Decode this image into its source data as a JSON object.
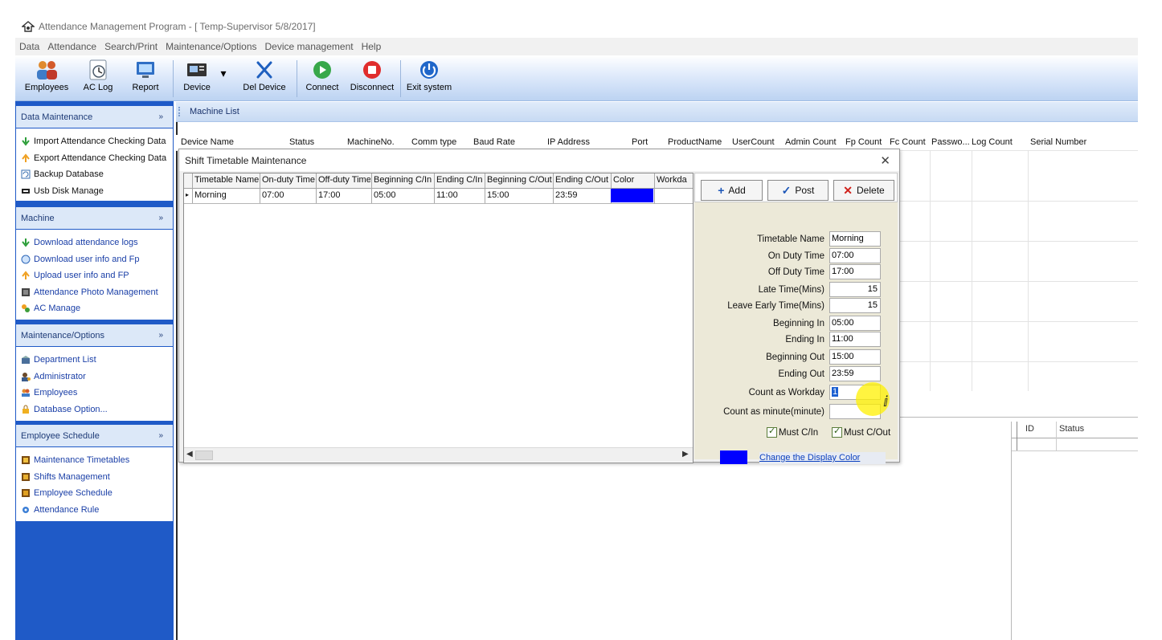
{
  "window": {
    "title": "Attendance Management Program - [ Temp-Supervisor 5/8/2017]"
  },
  "menu": [
    "Data",
    "Attendance",
    "Search/Print",
    "Maintenance/Options",
    "Device management",
    "Help"
  ],
  "toolbar": {
    "employees": "Employees",
    "ac_log": "AC Log",
    "report": "Report",
    "device": "Device",
    "del_device": "Del Device",
    "connect": "Connect",
    "disconnect": "Disconnect",
    "exit_system": "Exit system"
  },
  "sidebar": {
    "groups": [
      {
        "title": "Data Maintenance",
        "items": [
          "Import Attendance Checking Data",
          "Export Attendance Checking Data",
          "Backup Database",
          "Usb Disk Manage"
        ]
      },
      {
        "title": "Machine",
        "items": [
          "Download attendance logs",
          "Download user info and Fp",
          "Upload user info and FP",
          "Attendance Photo Management",
          "AC Manage"
        ]
      },
      {
        "title": "Maintenance/Options",
        "items": [
          "Department List",
          "Administrator",
          "Employees",
          "Database Option..."
        ]
      },
      {
        "title": "Employee Schedule",
        "items": [
          "Maintenance Timetables",
          "Shifts Management",
          "Employee Schedule",
          "Attendance Rule"
        ]
      }
    ],
    "collapse_glyph": "»"
  },
  "machine_list": {
    "title": "Machine List",
    "columns": [
      "Device Name",
      "Status",
      "MachineNo.",
      "Comm type",
      "Baud Rate",
      "IP Address",
      "Port",
      "ProductName",
      "UserCount",
      "Admin Count",
      "Fp Count",
      "Fc Count",
      "Passwo...",
      "Log Count",
      "Serial Number"
    ]
  },
  "sub_grid": {
    "columns": [
      "ID",
      "Status"
    ]
  },
  "dialog": {
    "title": "Shift Timetable Maintenance",
    "close": "✕",
    "table": {
      "columns": [
        "Timetable Name",
        "On-duty Time",
        "Off-duty Time",
        "Beginning C/In",
        "Ending C/In",
        "Beginning C/Out",
        "Ending C/Out",
        "Color",
        "Workda"
      ],
      "rows": [
        [
          "Morning",
          "07:00",
          "17:00",
          "05:00",
          "11:00",
          "15:00",
          "23:59",
          "",
          ""
        ]
      ],
      "row_indicator": "▸",
      "row_color": "#0000ff"
    },
    "buttons": {
      "add": "Add",
      "post": "Post",
      "delete": "Delete"
    },
    "fields": {
      "timetable_name": {
        "label": "Timetable Name",
        "value": "Morning"
      },
      "on_duty_time": {
        "label": "On Duty Time",
        "value": "07:00"
      },
      "off_duty_time": {
        "label": "Off Duty Time",
        "value": "17:00"
      },
      "late_time": {
        "label": "Late Time(Mins)",
        "value": "15"
      },
      "leave_early_time": {
        "label": "Leave Early Time(Mins)",
        "value": "15"
      },
      "beginning_in": {
        "label": "Beginning In",
        "value": "05:00"
      },
      "ending_in": {
        "label": "Ending In",
        "value": "11:00"
      },
      "beginning_out": {
        "label": "Beginning Out",
        "value": "15:00"
      },
      "ending_out": {
        "label": "Ending Out",
        "value": "23:59"
      },
      "count_as_workday": {
        "label": "Count as Workday",
        "value": "1"
      },
      "count_as_minute": {
        "label": "Count as minute(minute)",
        "value": ""
      }
    },
    "checkboxes": {
      "must_cin": "Must C/In",
      "must_cout": "Must C/Out"
    },
    "display_color": "#0000ff",
    "change_color_link": "Change the Display Color"
  }
}
